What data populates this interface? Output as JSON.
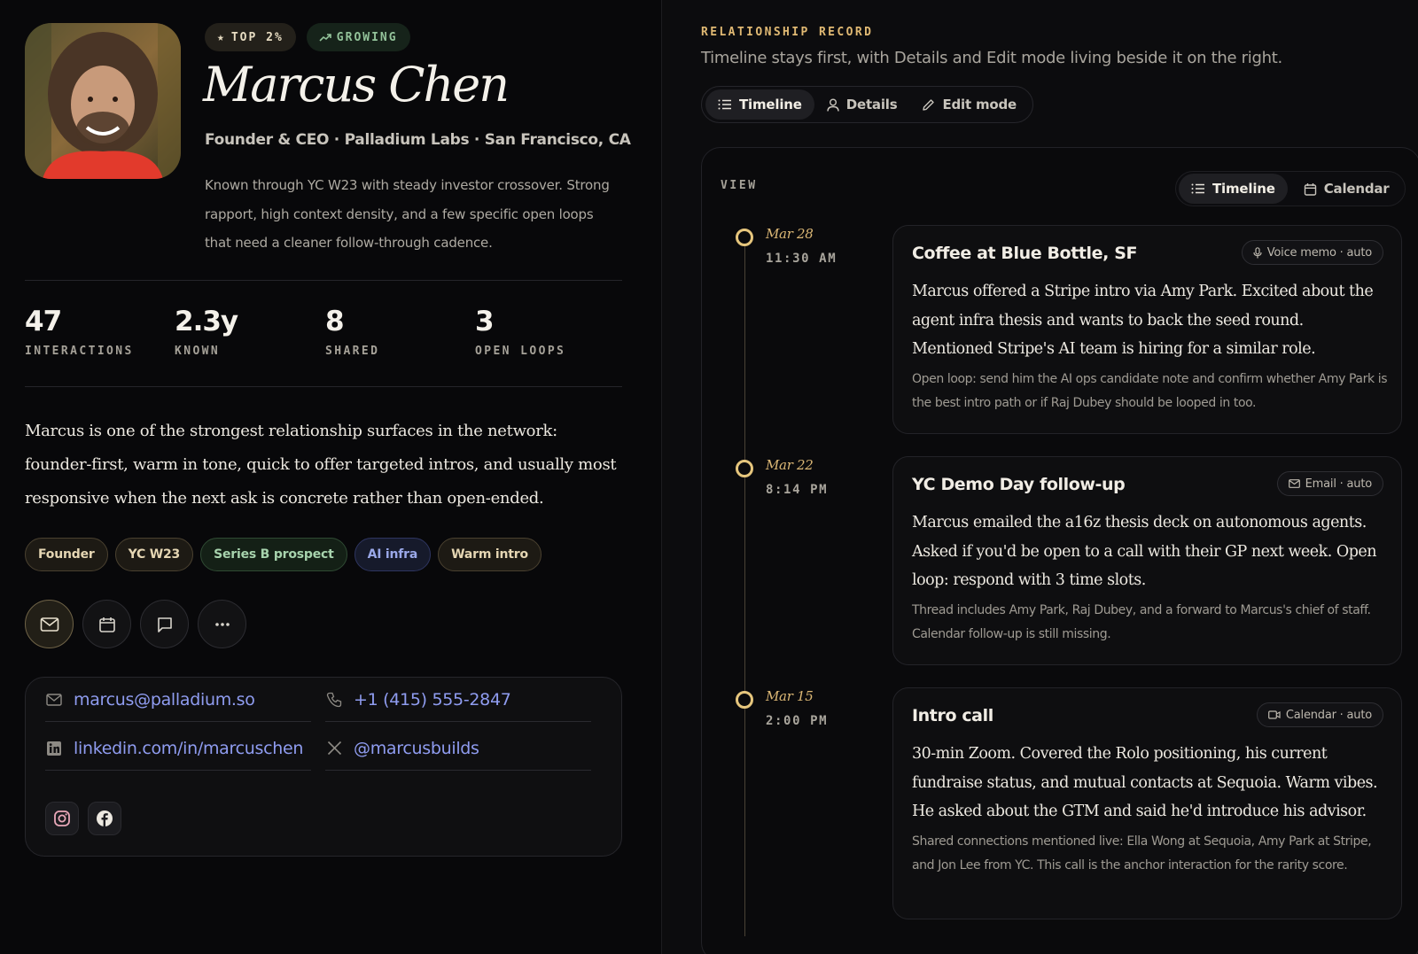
{
  "profile": {
    "badges": {
      "top": "TOP 2%",
      "growing": "GROWING"
    },
    "name": "Marcus Chen",
    "role": "Founder & CEO · Palladium Labs · San Francisco, CA",
    "blurb": "Known through YC W23 with steady investor crossover. Strong rapport, high context density, and a few specific open loops that need a cleaner follow-through cadence.",
    "stats": [
      {
        "value": "47",
        "label": "INTERACTIONS"
      },
      {
        "value": "2.3y",
        "label": "KNOWN"
      },
      {
        "value": "8",
        "label": "SHARED"
      },
      {
        "value": "3",
        "label": "OPEN LOOPS"
      }
    ],
    "summary": "Marcus is one of the strongest relationship surfaces in the network: founder-first, warm in tone, quick to offer targeted intros, and usually most responsive when the next ask is concrete rather than open-ended.",
    "tags": [
      "Founder",
      "YC W23",
      "Series B prospect",
      "AI infra",
      "Warm intro"
    ],
    "contact": {
      "email": "marcus@palladium.so",
      "phone": "+1 (415) 555-2847",
      "linkedin": "linkedin.com/in/marcuschen",
      "x": "@marcusbuilds"
    }
  },
  "record": {
    "title": "RELATIONSHIP RECORD",
    "subtitle": "Timeline stays first, with Details and Edit mode living beside it on the right.",
    "tabs": [
      "Timeline",
      "Details",
      "Edit mode"
    ],
    "view_label": "VIEW",
    "view_options": [
      "Timeline",
      "Calendar"
    ],
    "entries": [
      {
        "date": "Mar 28",
        "time": "11:30 AM",
        "title": "Coffee at Blue Bottle, SF",
        "chip": "Voice memo · auto",
        "body": "Marcus offered a Stripe intro via Amy Park. Excited about the agent infra thesis and wants to back the seed round. Mentioned Stripe's AI team is hiring for a similar role.",
        "note": "Open loop: send him the AI ops candidate note and confirm whether Amy Park is the best intro path or if Raj Dubey should be looped in too."
      },
      {
        "date": "Mar 22",
        "time": "8:14 PM",
        "title": "YC Demo Day follow-up",
        "chip": "Email · auto",
        "body": "Marcus emailed the a16z thesis deck on autonomous agents. Asked if you'd be open to a call with their GP next week. Open loop: respond with 3 time slots.",
        "note": "Thread includes Amy Park, Raj Dubey, and a forward to Marcus's chief of staff. Calendar follow-up is still missing."
      },
      {
        "date": "Mar 15",
        "time": "2:00 PM",
        "title": "Intro call",
        "chip": "Calendar · auto",
        "body": "30-min Zoom. Covered the Rolo positioning, his current fundraise status, and mutual contacts at Sequoia. Warm vibes. He asked about the GTM and said he'd introduce his advisor.",
        "note": "Shared connections mentioned live: Ella Wong at Sequoia, Amy Park at Stripe, and Jon Lee from YC. This call is the anchor interaction for the rarity score."
      }
    ]
  }
}
